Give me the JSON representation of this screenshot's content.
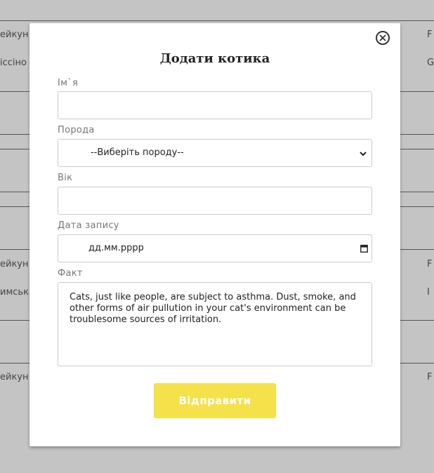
{
  "background": {
    "left_texts": [
      "ейкун",
      "іссіно",
      "ейкун",
      "имська",
      "ейкун"
    ],
    "right_texts": [
      "F",
      "G",
      "F",
      "I",
      "F"
    ]
  },
  "modal": {
    "title": "Додати котика",
    "fields": {
      "name": {
        "label": "Ім`я",
        "value": ""
      },
      "breed": {
        "label": "Порода",
        "selected": "--Виберіть породу--"
      },
      "age": {
        "label": "Вік",
        "value": ""
      },
      "date": {
        "label": "Дата запису",
        "placeholder": "дд.мм.рррр"
      },
      "fact": {
        "label": "Факт",
        "value": "Cats, just like people, are subject to asthma. Dust, smoke, and other forms of air pullution in your cat's environment can be troublesome sources of irritation."
      }
    },
    "submit_label": "Відправити"
  },
  "colors": {
    "overlay": "#c4c4c4",
    "submit_button": "#f5e14a"
  },
  "icons": [
    "close-icon",
    "chevron-down-icon",
    "calendar-icon"
  ]
}
